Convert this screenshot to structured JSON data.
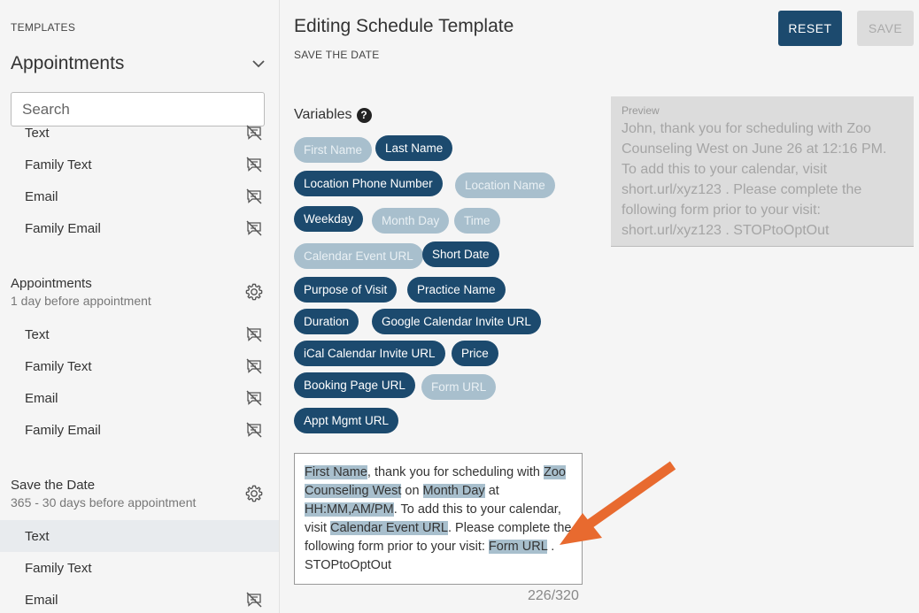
{
  "sidebar": {
    "templates_label": "TEMPLATES",
    "selected_template": "Appointments",
    "search_placeholder": "Search",
    "top_items": [
      {
        "label": "Text"
      },
      {
        "label": "Family Text"
      },
      {
        "label": "Email"
      },
      {
        "label": "Family Email"
      }
    ],
    "groups": [
      {
        "title": "Appointments",
        "subtitle": "1 day before appointment",
        "items": [
          {
            "label": "Text"
          },
          {
            "label": "Family Text"
          },
          {
            "label": "Email"
          },
          {
            "label": "Family Email"
          }
        ]
      },
      {
        "title": "Save the Date",
        "subtitle": "365 - 30 days before appointment",
        "items": [
          {
            "label": "Text",
            "active": true
          },
          {
            "label": "Family Text"
          },
          {
            "label": "Email"
          }
        ]
      }
    ]
  },
  "header": {
    "title": "Editing Schedule Template",
    "subtitle": "SAVE THE DATE",
    "reset_label": "RESET",
    "save_label": "SAVE"
  },
  "variables": {
    "label": "Variables",
    "help": "?",
    "chips": [
      {
        "label": "First Name",
        "active": false
      },
      {
        "label": "Last Name",
        "active": true
      },
      {
        "label": "Location Phone Number",
        "active": true
      },
      {
        "label": "Location Name",
        "active": false
      },
      {
        "label": "Weekday",
        "active": true
      },
      {
        "label": "Month Day",
        "active": false
      },
      {
        "label": "Time",
        "active": false
      },
      {
        "label": "Calendar Event URL",
        "active": false
      },
      {
        "label": "Short Date",
        "active": true
      },
      {
        "label": "Purpose of Visit",
        "active": true
      },
      {
        "label": "Practice Name",
        "active": true
      },
      {
        "label": "Duration",
        "active": true
      },
      {
        "label": "Google Calendar Invite URL",
        "active": true
      },
      {
        "label": "iCal Calendar Invite URL",
        "active": true
      },
      {
        "label": "Price",
        "active": true
      },
      {
        "label": "Booking Page URL",
        "active": true
      },
      {
        "label": "Form URL",
        "active": false
      },
      {
        "label": "Appt Mgmt URL",
        "active": true
      }
    ]
  },
  "preview": {
    "label": "Preview",
    "text": "John, thank you for scheduling with Zoo Counseling West on June 26 at 12:16 PM. To add this to your calendar, visit short.url/xyz123 . Please complete the following form prior to your visit: short.url/xyz123 . STOPtoOptOut"
  },
  "editor": {
    "v_first_name": "First Name",
    "t1": ", thank you for scheduling with ",
    "v_practice": "Zoo Counseling West",
    "t2": " on ",
    "v_month_day": "Month Day",
    "t3": " at ",
    "v_time": "HH:MM,AM/PM",
    "t4": ". To add this to your calendar, visit ",
    "v_calendar": "Calendar Event URL",
    "t5": ". Please complete the following form prior to your visit: ",
    "v_form": "Form URL",
    "t6": " . STOPtoOptOut",
    "counter": "226/320"
  },
  "colors": {
    "primary": "#1c4a6e",
    "chip_inactive": "#a8bfcd",
    "arrow": "#e86a2f"
  }
}
